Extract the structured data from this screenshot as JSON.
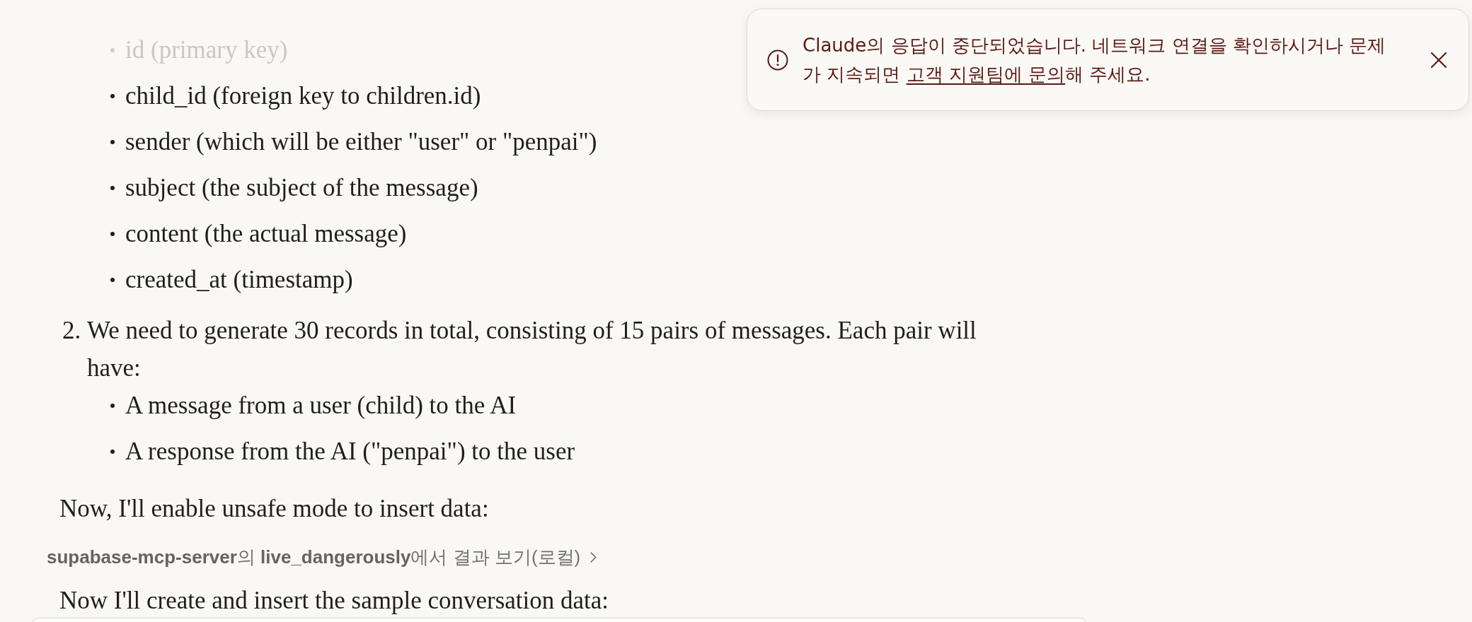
{
  "top_bullets": [
    {
      "text": "id (primary key)",
      "faded": true
    },
    {
      "text": "child_id (foreign key to children.id)",
      "faded": false
    },
    {
      "text": "sender (which will be either \"user\" or \"penpai\")",
      "faded": false
    },
    {
      "text": "subject (the subject of the message)",
      "faded": false
    },
    {
      "text": "content (the actual message)",
      "faded": false
    },
    {
      "text": "created_at (timestamp)",
      "faded": false
    }
  ],
  "numbered_item": {
    "number": "2.",
    "text": "We need to generate 30 records in total, consisting of 15 pairs of messages. Each pair will have:",
    "bullets": [
      "A message from a user (child) to the AI",
      "A response from the AI (\"penpai\") to the user"
    ]
  },
  "blocks": [
    {
      "kind": "paragraph",
      "text": "Now, I'll enable unsafe mode to insert data:"
    },
    {
      "kind": "tool_link",
      "text": "**supabase-mcp-server**의 **live_dangerously**에서 결과 보기(로컬)"
    },
    {
      "kind": "paragraph",
      "text": "Now I'll create and insert the sample conversation data:"
    }
  ],
  "toast": {
    "text_before": "Claude의 응답이 중단되었습니다. 네트워크 연결을 확인하시거나 문제가 지속되면 ",
    "link": "고객 지원팀에 문의",
    "text_after": "해 주세요."
  }
}
